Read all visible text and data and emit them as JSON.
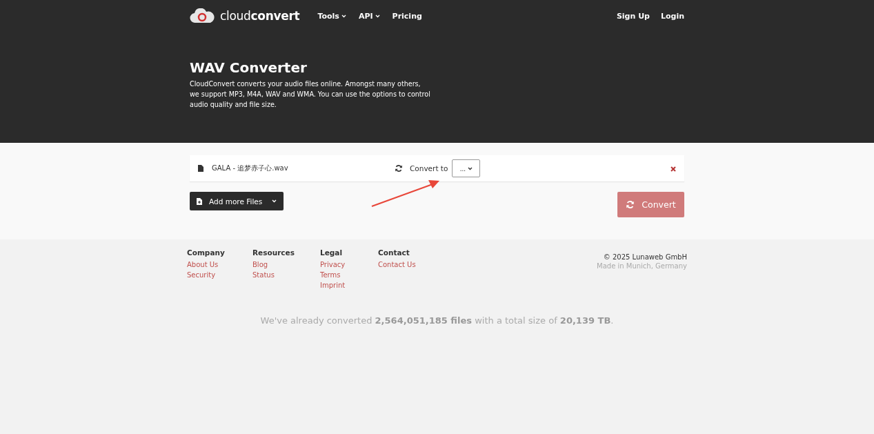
{
  "header": {
    "logo": "cloud**convert**",
    "nav": [
      {
        "label": "Tools",
        "dropdown": true
      },
      {
        "label": "API",
        "dropdown": true
      },
      {
        "label": "Pricing",
        "dropdown": false
      }
    ],
    "account": [
      "Sign Up",
      "Login"
    ]
  },
  "hero": {
    "title": "WAV Converter",
    "description": "CloudConvert converts your audio files online. Amongst many others, we support MP3, M4A, WAV and WMA. You can use the options to control audio quality and file size."
  },
  "file_row": {
    "filename": "GALA - 追梦赤子心.wav",
    "convert_label": "Convert to",
    "format_select": "..."
  },
  "add_files_button": "Add more Files",
  "convert_button": {
    "label": "Convert",
    "disabled": true
  },
  "footer": {
    "columns": [
      {
        "heading": "Company",
        "links": [
          "About Us",
          "Security"
        ]
      },
      {
        "heading": "Resources",
        "links": [
          "Blog",
          "Status"
        ]
      },
      {
        "heading": "Legal",
        "links": [
          "Privacy",
          "Terms",
          "Imprint"
        ]
      },
      {
        "heading": "Contact",
        "links": [
          "Contact Us"
        ]
      }
    ],
    "copyright": "© 2025 Lunaweb GmbH",
    "location": "Made in Munich, Germany"
  },
  "stats": "We've already converted **2,564,051,185 files** with a total size of **20,139 TB**."
}
